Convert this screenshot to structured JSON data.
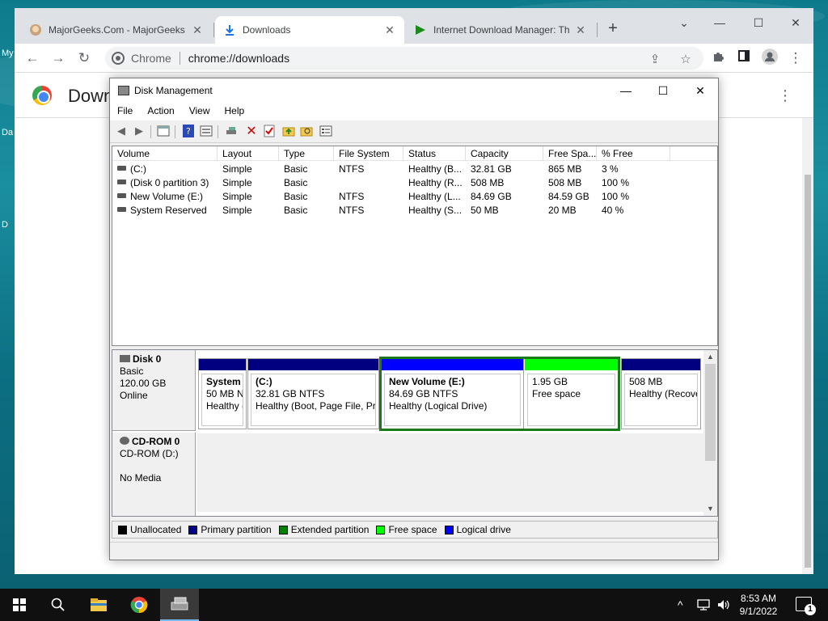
{
  "desktop": {
    "labels": [
      "My",
      "Da",
      "D"
    ]
  },
  "chrome": {
    "tabs": [
      {
        "title": "MajorGeeks.Com - MajorGeeks",
        "active": false
      },
      {
        "title": "Downloads",
        "active": true
      },
      {
        "title": "Internet Download Manager: Th",
        "active": false
      }
    ],
    "omnibox": {
      "chip": "Chrome",
      "url": "chrome://downloads"
    },
    "page_title": "Downl"
  },
  "disk_mgmt": {
    "title": "Disk Management",
    "menu": [
      "File",
      "Action",
      "View",
      "Help"
    ],
    "columns": [
      "Volume",
      "Layout",
      "Type",
      "File System",
      "Status",
      "Capacity",
      "Free Spa...",
      "% Free"
    ],
    "rows": [
      [
        "(C:)",
        "Simple",
        "Basic",
        "NTFS",
        "Healthy (B...",
        "32.81 GB",
        "865 MB",
        "3 %"
      ],
      [
        "(Disk 0 partition 3)",
        "Simple",
        "Basic",
        "",
        "Healthy (R...",
        "508 MB",
        "508 MB",
        "100 %"
      ],
      [
        "New Volume (E:)",
        "Simple",
        "Basic",
        "NTFS",
        "Healthy (L...",
        "84.69 GB",
        "84.59 GB",
        "100 %"
      ],
      [
        "System Reserved",
        "Simple",
        "Basic",
        "NTFS",
        "Healthy (S...",
        "50 MB",
        "20 MB",
        "40 %"
      ]
    ],
    "disk0": {
      "name": "Disk 0",
      "type": "Basic",
      "size": "120.00 GB",
      "state": "Online",
      "partitions": [
        {
          "name": "System R",
          "line1": "50 MB NT",
          "line2": "Healthy (",
          "bar": "#000080"
        },
        {
          "name": "(C:)",
          "line1": "32.81 GB NTFS",
          "line2": "Healthy (Boot, Page File, Pri",
          "bar": "#000080"
        },
        {
          "name": "New Volume  (E:)",
          "line1": "84.69 GB NTFS",
          "line2": "Healthy (Logical Drive)",
          "bar": "#0000ff"
        },
        {
          "name": "",
          "line1": "1.95 GB",
          "line2": "Free space",
          "bar": "#00ff00"
        },
        {
          "name": "",
          "line1": "508 MB",
          "line2": "Healthy (Recove",
          "bar": "#000080"
        }
      ]
    },
    "cdrom": {
      "name": "CD-ROM 0",
      "drive": "CD-ROM (D:)",
      "media": "No Media"
    },
    "legend": [
      {
        "label": "Unallocated",
        "color": "#000000"
      },
      {
        "label": "Primary partition",
        "color": "#000080"
      },
      {
        "label": "Extended partition",
        "color": "#008000"
      },
      {
        "label": "Free space",
        "color": "#00ff00"
      },
      {
        "label": "Logical drive",
        "color": "#0000ff"
      }
    ]
  },
  "taskbar": {
    "time": "8:53 AM",
    "date": "9/1/2022",
    "notifications": "1"
  }
}
